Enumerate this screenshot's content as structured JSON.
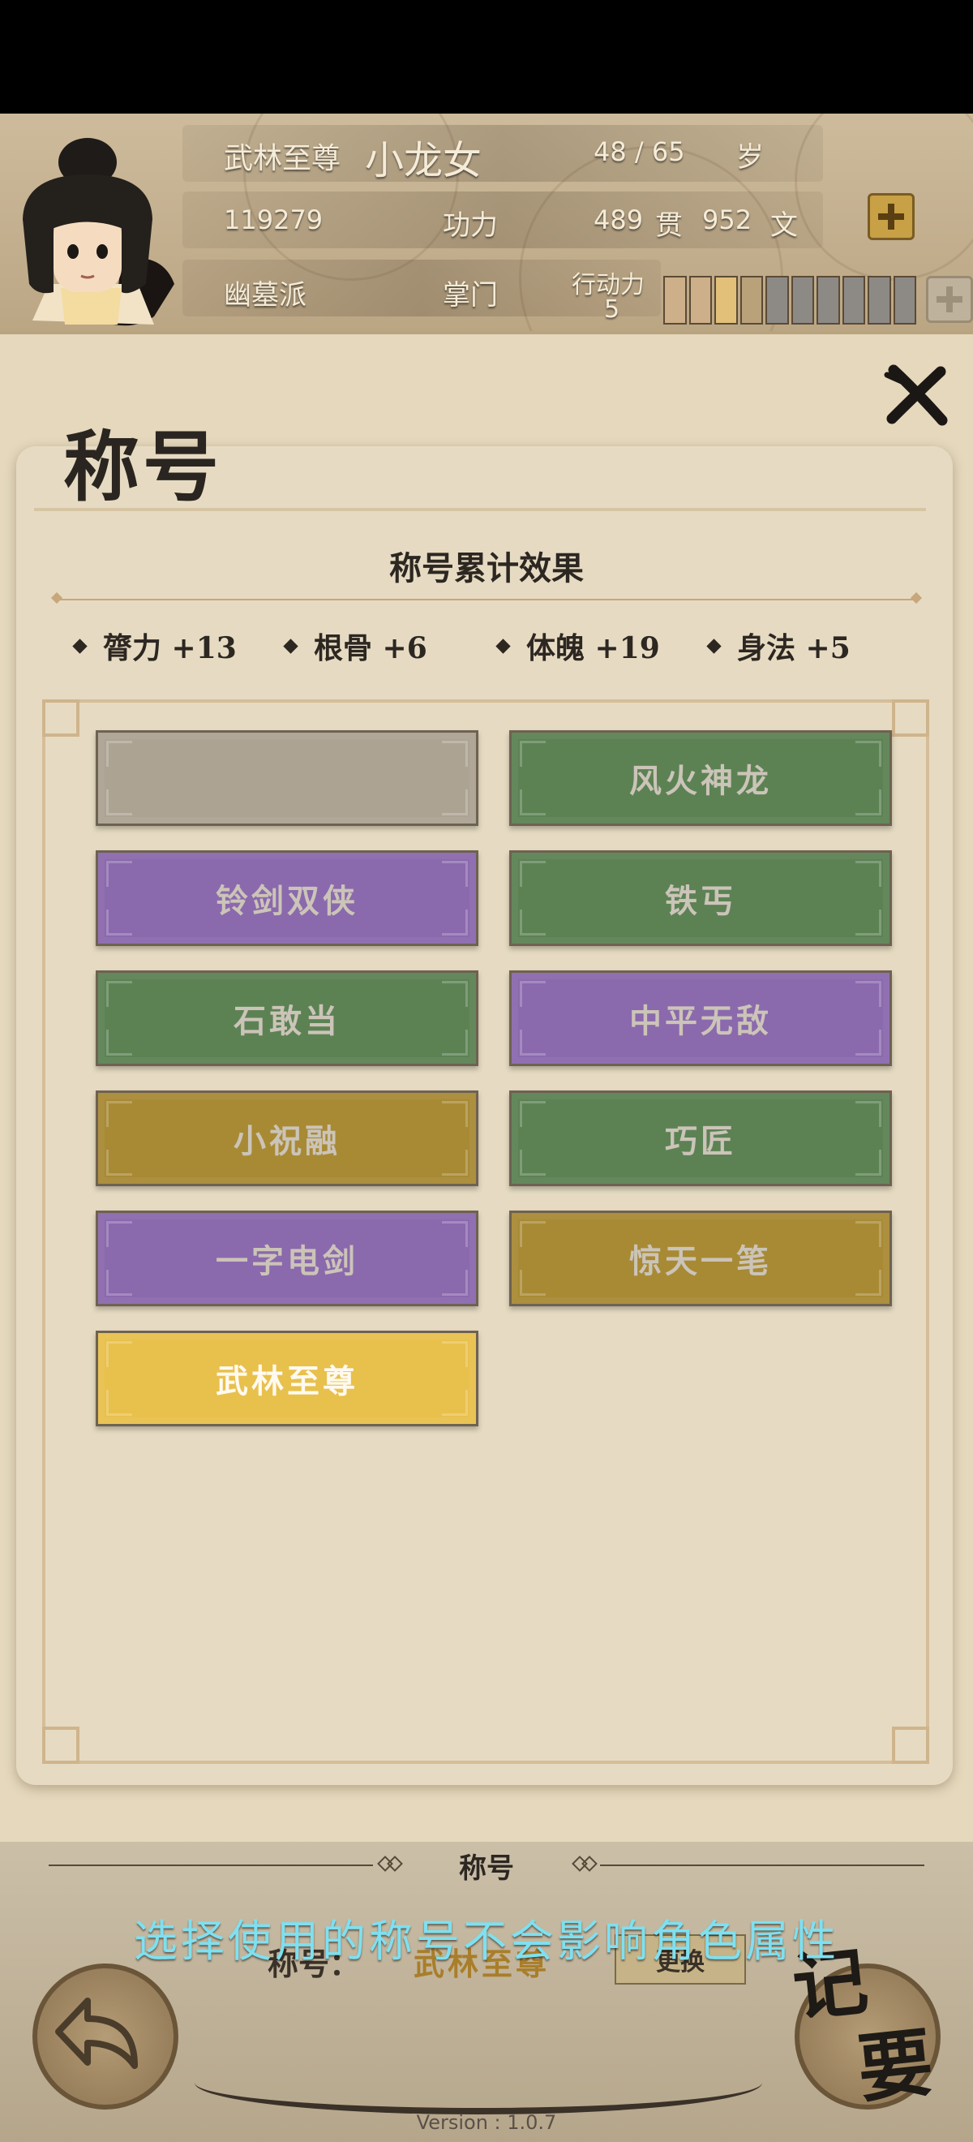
{
  "header": {
    "rank_title": "武林至尊",
    "name": "小龙女",
    "age": "48 / 65",
    "age_unit": "岁",
    "power_value": "119279",
    "power_label": "功力",
    "money_guan": "489",
    "money_guan_unit": "贯",
    "money_wen": "952",
    "money_wen_unit": "文",
    "sect": "幽墓派",
    "position": "掌门",
    "action_label": "行动力",
    "action_value": "5",
    "action_fill_fraction": 0.25
  },
  "panel": {
    "title": "称号",
    "subtitle": "称号累计效果",
    "stats": [
      {
        "label": "膂力 +13"
      },
      {
        "label": "根骨 +6"
      },
      {
        "label": "体魄 +19"
      },
      {
        "label": "身法 +5"
      }
    ],
    "titles": [
      {
        "label": "",
        "color": "#ada393"
      },
      {
        "label": "风火神龙",
        "color": "#5c8254"
      },
      {
        "label": "铃剑双侠",
        "color": "#8b69ad"
      },
      {
        "label": "铁丐",
        "color": "#5c8254"
      },
      {
        "label": "石敢当",
        "color": "#5c8254"
      },
      {
        "label": "中平无敌",
        "color": "#8b69ad"
      },
      {
        "label": "小祝融",
        "color": "#a88a35"
      },
      {
        "label": "巧匠",
        "color": "#5c8254"
      },
      {
        "label": "一字电剑",
        "color": "#8b69ad"
      },
      {
        "label": "惊天一笔",
        "color": "#a88a35"
      },
      {
        "label": "武林至尊",
        "color": "#e8c04c"
      }
    ]
  },
  "bottom": {
    "section_title": "称号",
    "tip": "选择使用的称号不会影响角色属性",
    "current_label": "称号：",
    "current_title": "武林至尊",
    "change_button": "更换",
    "memo": "记要",
    "version": "Version : 1.0.7"
  }
}
